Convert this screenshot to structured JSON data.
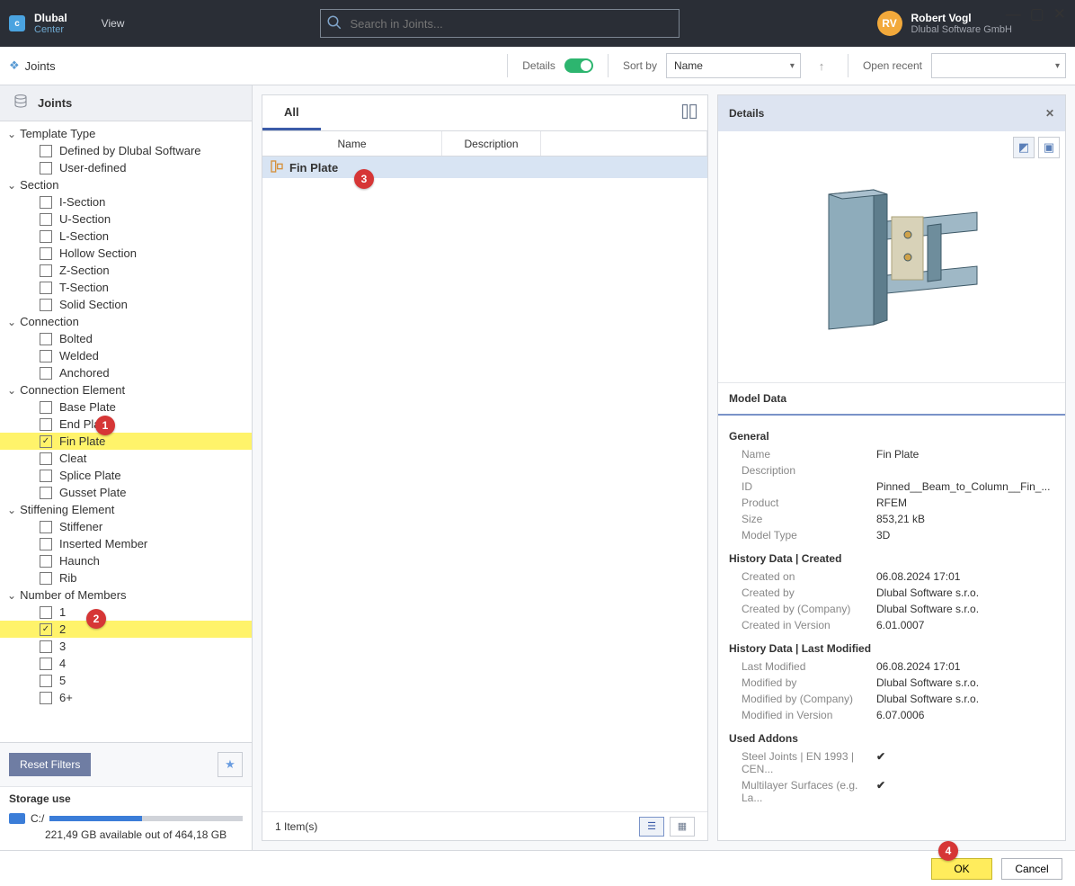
{
  "app": {
    "brand": "Dlubal",
    "sub": "Center",
    "menu_view": "View",
    "search_placeholder": "Search in Joints...",
    "user_name": "Robert Vogl",
    "user_company": "Dlubal Software GmbH",
    "user_initials": "RV"
  },
  "toolbar": {
    "joints": "Joints",
    "details": "Details",
    "sortby": "Sort by",
    "sort_val": "Name",
    "open_recent": "Open recent",
    "open_recent_val": ""
  },
  "sidebar": {
    "title": "Joints",
    "g1": "Template Type",
    "g1a": "Defined by Dlubal Software",
    "g1b": "User-defined",
    "g2": "Section",
    "g2a": "I-Section",
    "g2b": "U-Section",
    "g2c": "L-Section",
    "g2d": "Hollow Section",
    "g2e": "Z-Section",
    "g2f": "T-Section",
    "g2g": "Solid Section",
    "g3": "Connection",
    "g3a": "Bolted",
    "g3b": "Welded",
    "g3c": "Anchored",
    "g4": "Connection Element",
    "g4a": "Base Plate",
    "g4b": "End Plate",
    "g4c": "Fin Plate",
    "g4d": "Cleat",
    "g4e": "Splice Plate",
    "g4f": "Gusset Plate",
    "g5": "Stiffening Element",
    "g5a": "Stiffener",
    "g5b": "Inserted Member",
    "g5c": "Haunch",
    "g5d": "Rib",
    "g6": "Number of Members",
    "g6a": "1",
    "g6b": "2",
    "g6c": "3",
    "g6d": "4",
    "g6e": "5",
    "g6f": "6+",
    "reset": "Reset Filters",
    "storage": "Storage use",
    "drive": "C:/",
    "storage_txt": "221,49 GB available out of 464,18 GB"
  },
  "main": {
    "tab_all": "All",
    "hdr_name": "Name",
    "hdr_desc": "Description",
    "row_name": "Fin Plate",
    "status": "1 Item(s)"
  },
  "details": {
    "title": "Details",
    "model_data": "Model Data",
    "s_general": "General",
    "k_name": "Name",
    "v_name": "Fin Plate",
    "k_desc": "Description",
    "v_desc": "",
    "k_id": "ID",
    "v_id": "Pinned__Beam_to_Column__Fin_...",
    "k_prod": "Product",
    "v_prod": "RFEM",
    "k_size": "Size",
    "v_size": "853,21 kB",
    "k_mtype": "Model Type",
    "v_mtype": "3D",
    "s_created": "History Data | Created",
    "k_con": "Created on",
    "v_con": "06.08.2024 17:01",
    "k_cby": "Created by",
    "v_cby": "Dlubal Software s.r.o.",
    "k_ccom": "Created by (Company)",
    "v_ccom": "Dlubal Software s.r.o.",
    "k_cver": "Created in Version",
    "v_cver": "6.01.0007",
    "s_modified": "History Data | Last Modified",
    "k_mon": "Last Modified",
    "v_mon": "06.08.2024 17:01",
    "k_mby": "Modified by",
    "v_mby": "Dlubal Software s.r.o.",
    "k_mcom": "Modified by (Company)",
    "v_mcom": "Dlubal Software s.r.o.",
    "k_mver": "Modified in Version",
    "v_mver": "6.07.0006",
    "s_addons": "Used Addons",
    "k_a1": "Steel Joints | EN 1993 | CEN...",
    "k_a2": "Multilayer Surfaces (e.g. La..."
  },
  "footer": {
    "ok": "OK",
    "cancel": "Cancel"
  }
}
